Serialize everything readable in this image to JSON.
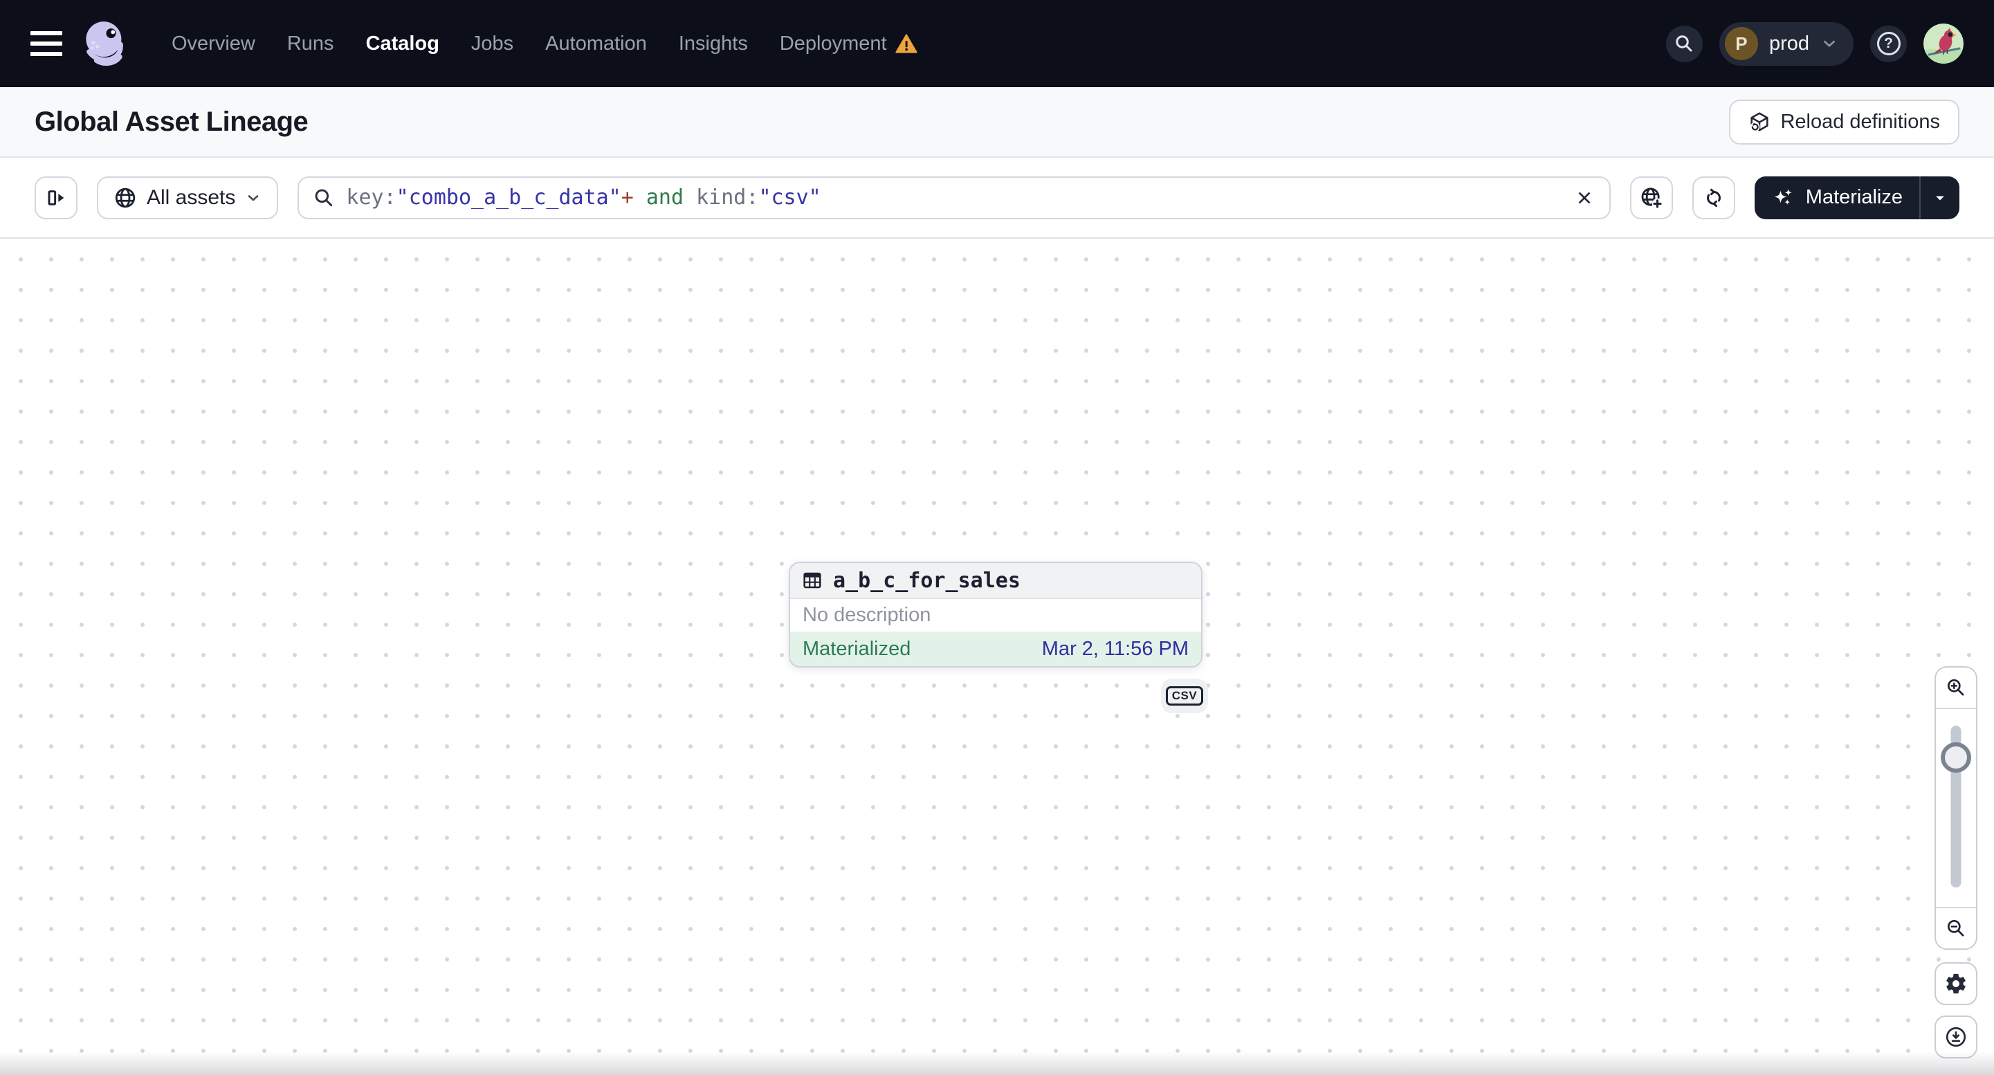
{
  "nav": {
    "items": [
      {
        "label": "Overview",
        "active": false
      },
      {
        "label": "Runs",
        "active": false
      },
      {
        "label": "Catalog",
        "active": true
      },
      {
        "label": "Jobs",
        "active": false
      },
      {
        "label": "Automation",
        "active": false
      },
      {
        "label": "Insights",
        "active": false
      },
      {
        "label": "Deployment",
        "active": false,
        "warning": true
      }
    ],
    "environment": {
      "initial": "P",
      "name": "prod"
    },
    "help_glyph": "?"
  },
  "header": {
    "title": "Global Asset Lineage",
    "reload_label": "Reload definitions"
  },
  "filterbar": {
    "scope_label": "All assets",
    "query_parts": [
      {
        "text": "key:"
      },
      {
        "text": "\"combo_a_b_c_data\""
      },
      {
        "text": "+"
      },
      {
        "text": " and "
      },
      {
        "text": "kind:"
      },
      {
        "text": "\"csv\""
      }
    ],
    "materialize_label": "Materialize"
  },
  "canvas": {
    "node": {
      "title": "a_b_c_for_sales",
      "description": "No description",
      "status": "Materialized",
      "timestamp": "Mar 2, 11:56 PM",
      "kind_badge": "CSV"
    }
  },
  "colors": {
    "nav_background": "#0c0f1a",
    "status_green": "#2b7c51",
    "status_green_bg": "#e3f2e9",
    "timestamp_indigo": "#302da0",
    "warning_amber": "#efa33c",
    "materialize_bg": "#181d2b",
    "query_value_indigo": "#3733a6",
    "query_and_green": "#2e7b4e",
    "query_plus_red": "#a03a2c"
  }
}
